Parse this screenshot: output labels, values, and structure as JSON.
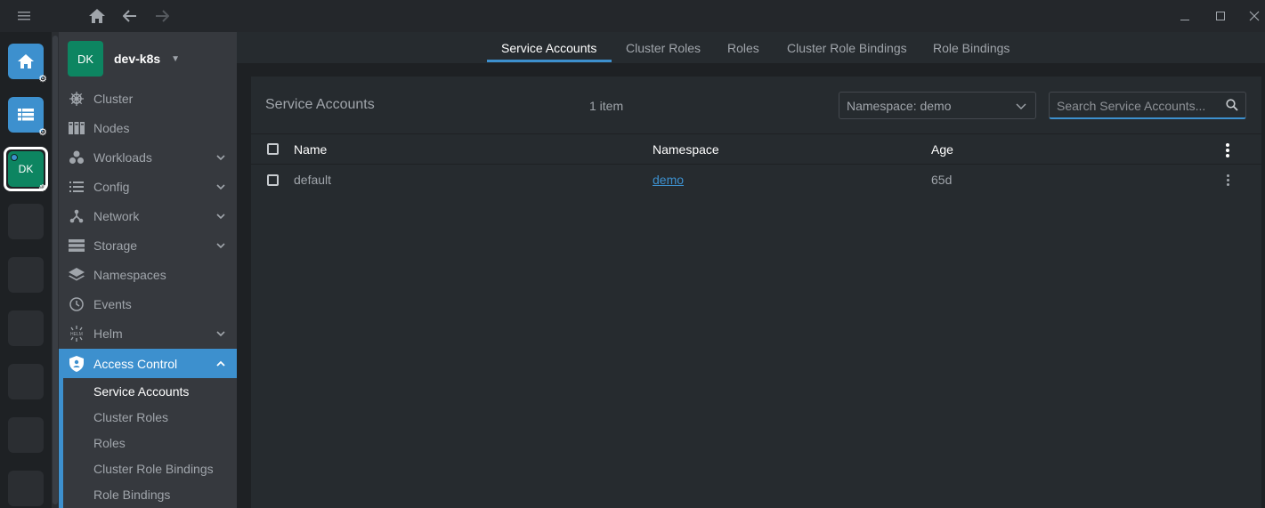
{
  "window": {
    "controls": [
      "minimize-icon",
      "maximize-icon",
      "close-icon"
    ]
  },
  "nav": {
    "icons": [
      "menu-icon",
      "home-icon",
      "back-icon",
      "forward-icon"
    ]
  },
  "hotbar": {
    "cluster_initials": "DK",
    "items": [
      "home-icon",
      "catalog-icon",
      "cluster"
    ]
  },
  "cluster": {
    "initials": "DK",
    "name": "dev-k8s"
  },
  "sidebar": {
    "items": [
      {
        "label": "Cluster",
        "icon": "helm-wheel-icon"
      },
      {
        "label": "Nodes",
        "icon": "nodes-icon"
      },
      {
        "label": "Workloads",
        "icon": "workloads-icon",
        "expandable": true
      },
      {
        "label": "Config",
        "icon": "config-list-icon",
        "expandable": true
      },
      {
        "label": "Network",
        "icon": "network-icon",
        "expandable": true
      },
      {
        "label": "Storage",
        "icon": "storage-icon",
        "expandable": true
      },
      {
        "label": "Namespaces",
        "icon": "layers-icon"
      },
      {
        "label": "Events",
        "icon": "clock-icon"
      },
      {
        "label": "Helm",
        "icon": "helm-icon",
        "expandable": true
      },
      {
        "label": "Access Control",
        "icon": "shield-icon",
        "expandable": true,
        "selected": true
      }
    ],
    "sub_items": [
      "Service Accounts",
      "Cluster Roles",
      "Roles",
      "Cluster Role Bindings",
      "Role Bindings"
    ]
  },
  "tabs": [
    "Service Accounts",
    "Cluster Roles",
    "Roles",
    "Cluster Role Bindings",
    "Role Bindings"
  ],
  "content": {
    "title": "Service Accounts",
    "count": "1 item",
    "namespace_select": "Namespace: demo",
    "search_placeholder": "Search Service Accounts...",
    "columns": [
      "Name",
      "Namespace",
      "Age"
    ],
    "rows": [
      {
        "name": "default",
        "namespace": "demo",
        "age": "65d"
      }
    ]
  },
  "colors": {
    "accent": "#3d90ce",
    "cluster": "#0d8561"
  }
}
